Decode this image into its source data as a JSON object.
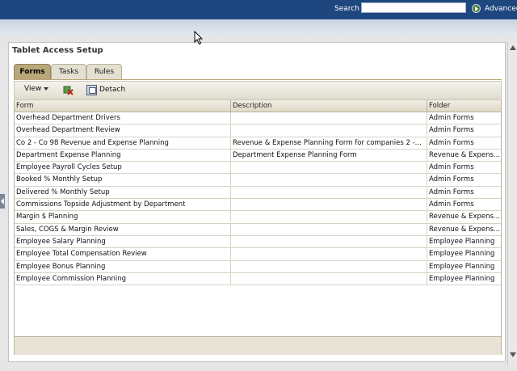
{
  "header": {
    "search_label": "Search",
    "search_value": "",
    "advanced_label": "Advanced"
  },
  "panel": {
    "title": "Tablet Access Setup",
    "tabs": [
      {
        "label": "Forms",
        "active": true
      },
      {
        "label": "Tasks",
        "active": false
      },
      {
        "label": "Rules",
        "active": false
      }
    ],
    "toolbar": {
      "view_label": "View",
      "detach_label": "Detach"
    }
  },
  "table": {
    "columns": [
      "Form",
      "Description",
      "Folder"
    ],
    "rows": [
      {
        "form": "Overhead Department Drivers",
        "description": "",
        "folder": "Admin Forms"
      },
      {
        "form": "Overhead Department Review",
        "description": "",
        "folder": "Admin Forms"
      },
      {
        "form": "Co 2 - Co 98 Revenue and Expense Planning",
        "description": "Revenue & Expense Planning Form for companies 2 -...",
        "folder": "Admin Forms"
      },
      {
        "form": "Department Expense Planning",
        "description": "Department Expense Planning Form",
        "folder": "Revenue & Expens..."
      },
      {
        "form": "Employee Payroll Cycles Setup",
        "description": "",
        "folder": "Admin Forms"
      },
      {
        "form": "Booked % Monthly Setup",
        "description": "",
        "folder": "Admin Forms"
      },
      {
        "form": "Delivered % Monthly Setup",
        "description": "",
        "folder": "Admin Forms"
      },
      {
        "form": "Commissions Topside Adjustment by Department",
        "description": "",
        "folder": "Admin Forms"
      },
      {
        "form": "Margin $ Planning",
        "description": "",
        "folder": "Revenue & Expens..."
      },
      {
        "form": "Sales, COGS & Margin Review",
        "description": "",
        "folder": "Revenue & Expens..."
      },
      {
        "form": "Employee Salary Planning",
        "description": "",
        "folder": "Employee Planning"
      },
      {
        "form": "Employee Total Compensation Review",
        "description": "",
        "folder": "Employee Planning"
      },
      {
        "form": "Employee Bonus Planning",
        "description": "",
        "folder": "Employee Planning"
      },
      {
        "form": "Employee Commission Planning",
        "description": "",
        "folder": "Employee Planning"
      }
    ]
  },
  "icons": {
    "go": "go-arrow-icon",
    "freeze": "freeze-columns-icon",
    "detach": "detach-icon",
    "collapse": "collapse-handle-icon"
  },
  "colors": {
    "header_bar": "#1f477f",
    "active_tab": "#b8a779",
    "tab": "#e3dfd1"
  }
}
